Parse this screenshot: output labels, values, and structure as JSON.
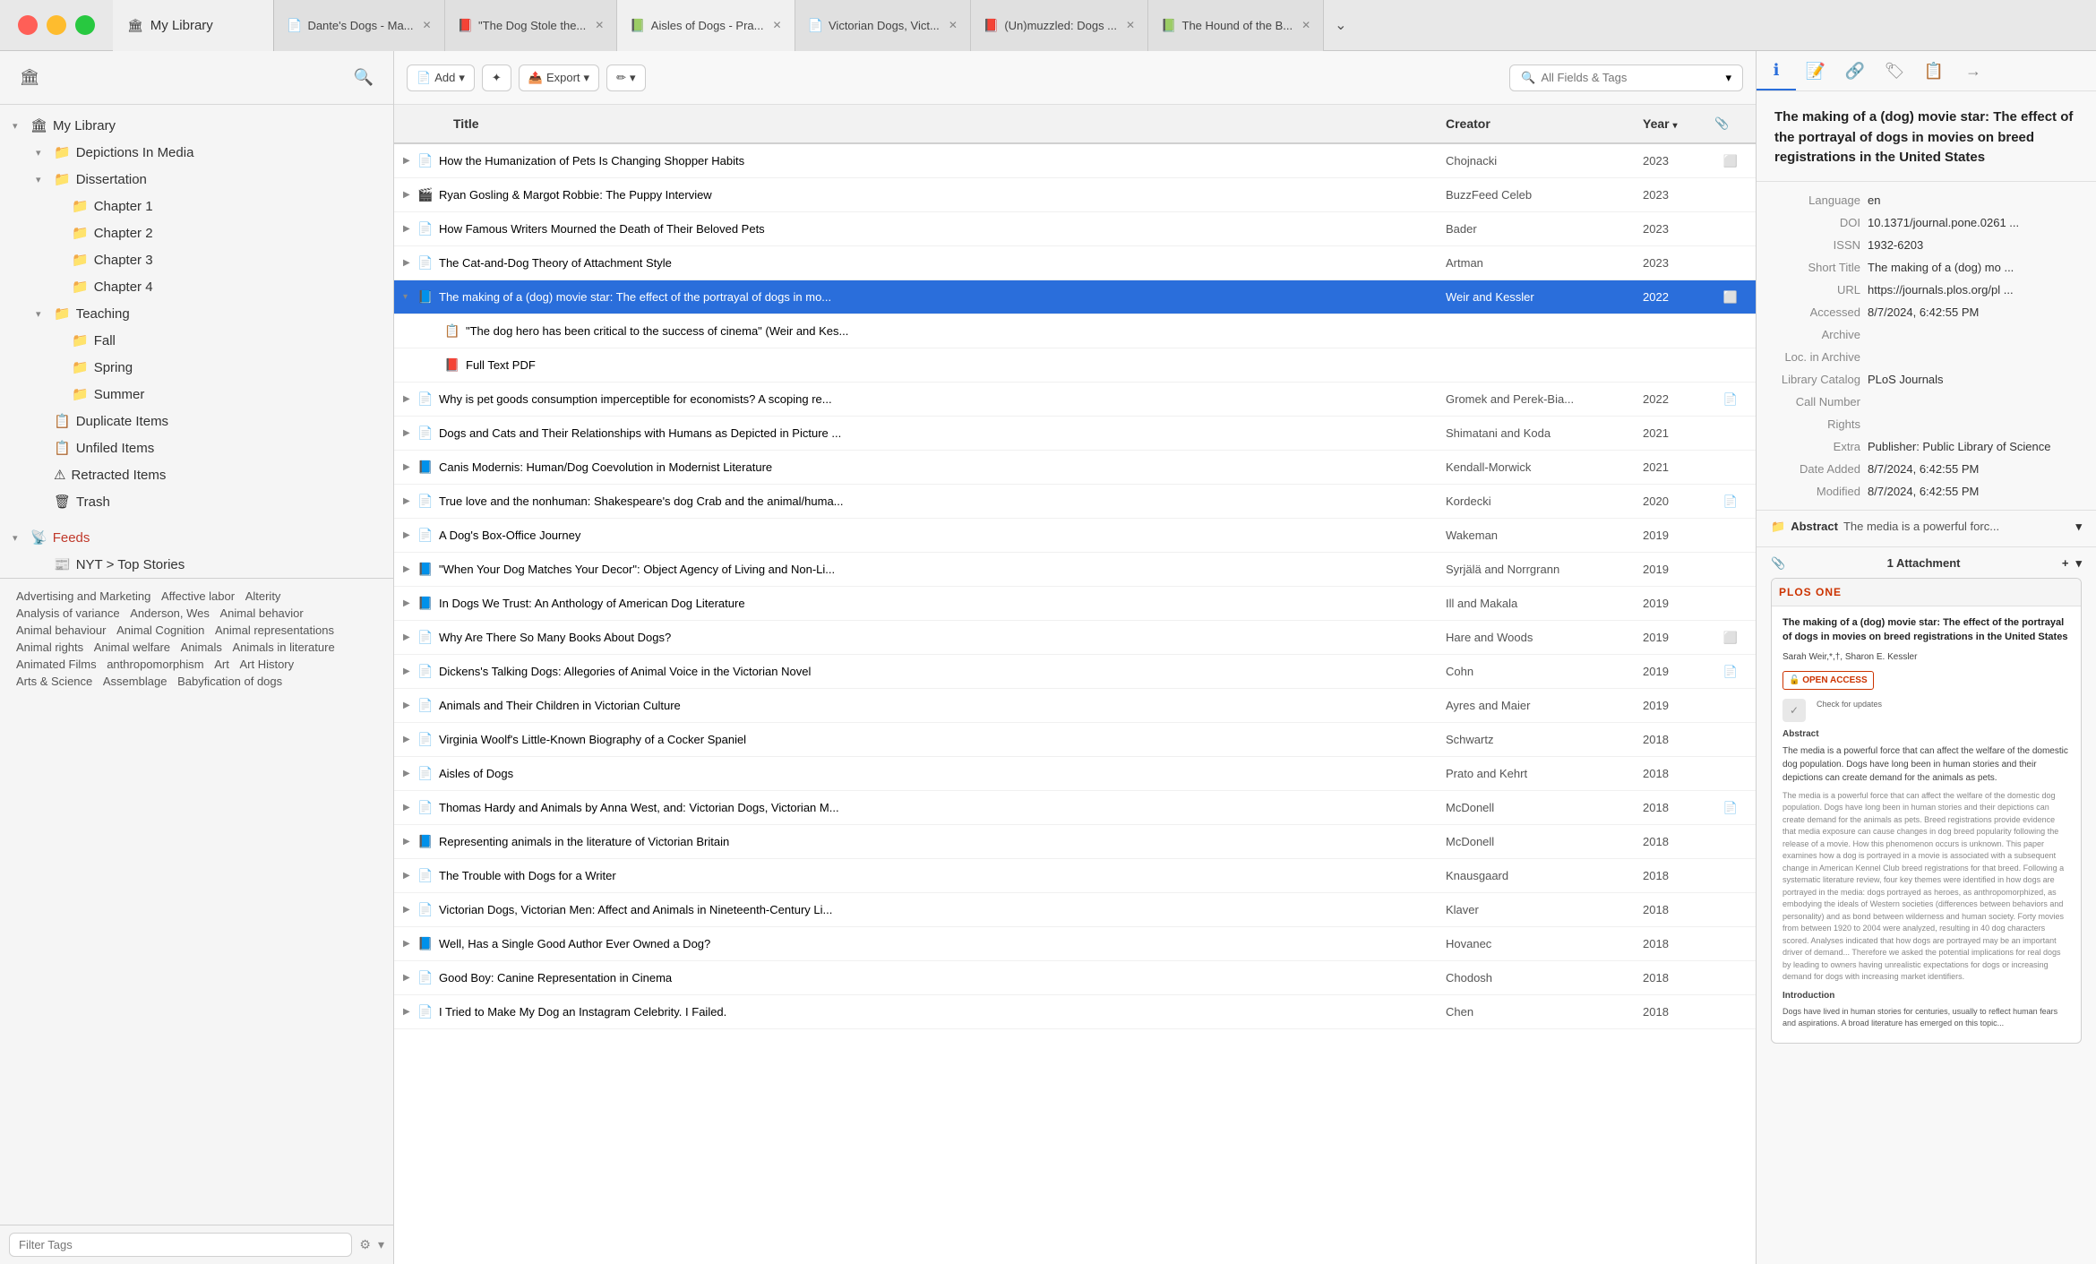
{
  "titleBar": {
    "tabs": [
      {
        "id": "my-library",
        "icon": "🏛",
        "label": "My Library",
        "active": false,
        "closeable": false
      },
      {
        "id": "dantes-dogs",
        "icon": "📄",
        "label": "Dante's Dogs - Ma...",
        "active": false,
        "closeable": true
      },
      {
        "id": "dog-stole",
        "icon": "📕",
        "label": "\"The Dog Stole the...",
        "active": false,
        "closeable": true
      },
      {
        "id": "aisles-of-dogs",
        "icon": "📗",
        "label": "Aisles of Dogs - Pra...",
        "active": true,
        "closeable": true
      },
      {
        "id": "victorian-dogs",
        "icon": "📄",
        "label": "Victorian Dogs, Vict...",
        "active": false,
        "closeable": true
      },
      {
        "id": "unmuzzled",
        "icon": "📕",
        "label": "(Un)muzzled: Dogs ...",
        "active": false,
        "closeable": true
      },
      {
        "id": "hound",
        "icon": "📗",
        "label": "The Hound of the B...",
        "active": false,
        "closeable": true
      }
    ]
  },
  "toolbar": {
    "addBtn": "Add",
    "wandBtn": "✦",
    "exportBtn": "Export",
    "annotateBtn": "✏",
    "searchPlaceholder": "All Fields & Tags"
  },
  "sidebar": {
    "title": "My Library",
    "items": [
      {
        "id": "my-library",
        "label": "My Library",
        "icon": "🏛",
        "arrow": "▾",
        "indent": 0
      },
      {
        "id": "depictions-in-media",
        "label": "Depictions In Media",
        "icon": "📁",
        "arrow": "▾",
        "indent": 1
      },
      {
        "id": "dissertation",
        "label": "Dissertation",
        "icon": "📁",
        "arrow": "▾",
        "indent": 1
      },
      {
        "id": "chapter1",
        "label": "Chapter 1",
        "icon": "📁",
        "arrow": "",
        "indent": 2
      },
      {
        "id": "chapter2",
        "label": "Chapter 2",
        "icon": "📁",
        "arrow": "",
        "indent": 2
      },
      {
        "id": "chapter3",
        "label": "Chapter 3",
        "icon": "📁",
        "arrow": "",
        "indent": 2
      },
      {
        "id": "chapter4",
        "label": "Chapter 4",
        "icon": "📁",
        "arrow": "",
        "indent": 2
      },
      {
        "id": "teaching",
        "label": "Teaching",
        "icon": "📁",
        "arrow": "▾",
        "indent": 1
      },
      {
        "id": "fall",
        "label": "Fall",
        "icon": "📁",
        "arrow": "",
        "indent": 2
      },
      {
        "id": "spring",
        "label": "Spring",
        "icon": "📁",
        "arrow": "",
        "indent": 2
      },
      {
        "id": "summer",
        "label": "Summer",
        "icon": "📁",
        "arrow": "",
        "indent": 2
      },
      {
        "id": "duplicate-items",
        "label": "Duplicate Items",
        "icon": "📋",
        "arrow": "",
        "indent": 1
      },
      {
        "id": "unfiled-items",
        "label": "Unfiled Items",
        "icon": "📋",
        "arrow": "",
        "indent": 1
      },
      {
        "id": "retracted-items",
        "label": "Retracted Items",
        "icon": "⚠",
        "arrow": "",
        "indent": 1
      },
      {
        "id": "trash",
        "label": "Trash",
        "icon": "🗑",
        "arrow": "",
        "indent": 1
      }
    ],
    "feeds": {
      "label": "Feeds",
      "children": [
        {
          "id": "nyt",
          "label": "NYT > Top Stories",
          "icon": "📰"
        }
      ]
    },
    "tags": [
      "Advertising and Marketing",
      "Affective labor",
      "Alterity",
      "Analysis of variance",
      "Anderson, Wes",
      "Animal behavior",
      "Animal behaviour",
      "Animal Cognition",
      "Animal representations",
      "Animal rights",
      "Animal welfare",
      "Animals",
      "Animals in literature",
      "Animated Films",
      "anthropomorphism",
      "Art",
      "Art History",
      "Arts & Science",
      "Assemblage",
      "Babyfication of dogs"
    ],
    "filterPlaceholder": "Filter Tags"
  },
  "tableHeader": {
    "titleCol": "Title",
    "creatorCol": "Creator",
    "yearCol": "Year",
    "attachCol": ""
  },
  "tableRows": [
    {
      "title": "How the Humanization of Pets Is Changing Shopper Habits",
      "creator": "Chojnacki",
      "year": "2023",
      "attach": "cloud",
      "icon": "📄",
      "expanded": false,
      "sub": false
    },
    {
      "title": "Ryan Gosling & Margot Robbie: The Puppy Interview",
      "creator": "BuzzFeed Celeb",
      "year": "2023",
      "attach": "",
      "icon": "🎬",
      "expanded": false,
      "sub": false
    },
    {
      "title": "How Famous Writers Mourned the Death of Their Beloved Pets",
      "creator": "Bader",
      "year": "2023",
      "attach": "",
      "icon": "📄",
      "expanded": false,
      "sub": false
    },
    {
      "title": "The Cat-and-Dog Theory of Attachment Style",
      "creator": "Artman",
      "year": "2023",
      "attach": "",
      "icon": "📄",
      "expanded": false,
      "sub": false
    },
    {
      "title": "The making of a (dog) movie star: The effect of the portrayal of dogs in mo...",
      "creator": "Weir and Kessler",
      "year": "2022",
      "attach": "cloud",
      "icon": "📘",
      "expanded": true,
      "selected": true,
      "sub": false
    },
    {
      "title": "\"The dog hero has been critical to the success of cinema\" (Weir and Kes...",
      "creator": "",
      "year": "",
      "attach": "",
      "icon": "📋",
      "expanded": false,
      "sub": true
    },
    {
      "title": "Full Text PDF",
      "creator": "",
      "year": "",
      "attach": "",
      "icon": "📕",
      "expanded": false,
      "sub": true
    },
    {
      "title": "Why is pet goods consumption imperceptible for economists? A scoping re...",
      "creator": "Gromek and Perek-Bia...",
      "year": "2022",
      "attach": "pdf",
      "icon": "📄",
      "expanded": false,
      "sub": false
    },
    {
      "title": "Dogs and Cats and Their Relationships with Humans as Depicted in Picture ...",
      "creator": "Shimatani and Koda",
      "year": "2021",
      "attach": "",
      "icon": "📄",
      "expanded": false,
      "sub": false
    },
    {
      "title": "Canis Modernis: Human/Dog Coevolution in Modernist Literature",
      "creator": "Kendall-Morwick",
      "year": "2021",
      "attach": "",
      "icon": "📘",
      "expanded": false,
      "sub": false
    },
    {
      "title": "True love and the nonhuman: Shakespeare's dog Crab and the animal/huma...",
      "creator": "Kordecki",
      "year": "2020",
      "attach": "pdf",
      "icon": "📄",
      "expanded": false,
      "sub": false
    },
    {
      "title": "A Dog's Box-Office Journey",
      "creator": "Wakeman",
      "year": "2019",
      "attach": "",
      "icon": "📄",
      "expanded": false,
      "sub": false
    },
    {
      "title": "\"When Your Dog Matches Your Decor\": Object Agency of Living and Non-Li...",
      "creator": "Syrjälä and Norrgrann",
      "year": "2019",
      "attach": "",
      "icon": "📘",
      "expanded": false,
      "sub": false
    },
    {
      "title": "In Dogs We Trust: An Anthology of American Dog Literature",
      "creator": "Ill and Makala",
      "year": "2019",
      "attach": "",
      "icon": "📘",
      "expanded": false,
      "sub": false
    },
    {
      "title": "Why Are There So Many Books About Dogs?",
      "creator": "Hare and Woods",
      "year": "2019",
      "attach": "cloud",
      "icon": "📄",
      "expanded": false,
      "sub": false
    },
    {
      "title": "Dickens's Talking Dogs: Allegories of Animal Voice in the Victorian Novel",
      "creator": "Cohn",
      "year": "2019",
      "attach": "pdf",
      "icon": "📄",
      "expanded": false,
      "sub": false
    },
    {
      "title": "Animals and Their Children in Victorian Culture",
      "creator": "Ayres and Maier",
      "year": "2019",
      "attach": "",
      "icon": "📄",
      "expanded": false,
      "sub": false
    },
    {
      "title": "Virginia Woolf's Little-Known Biography of a Cocker Spaniel",
      "creator": "Schwartz",
      "year": "2018",
      "attach": "",
      "icon": "📄",
      "expanded": false,
      "sub": false
    },
    {
      "title": "Aisles of Dogs",
      "creator": "Prato and Kehrt",
      "year": "2018",
      "attach": "",
      "icon": "📄",
      "expanded": false,
      "sub": false
    },
    {
      "title": "Thomas Hardy and Animals by Anna West, and: Victorian Dogs, Victorian M...",
      "creator": "McDonell",
      "year": "2018",
      "attach": "pdf",
      "icon": "📄",
      "expanded": false,
      "sub": false
    },
    {
      "title": "Representing animals in the literature of Victorian Britain",
      "creator": "McDonell",
      "year": "2018",
      "attach": "",
      "icon": "📘",
      "expanded": false,
      "sub": false
    },
    {
      "title": "The Trouble with Dogs for a Writer",
      "creator": "Knausgaard",
      "year": "2018",
      "attach": "",
      "icon": "📄",
      "expanded": false,
      "sub": false
    },
    {
      "title": "Victorian Dogs, Victorian Men: Affect and Animals in Nineteenth-Century Li...",
      "creator": "Klaver",
      "year": "2018",
      "attach": "",
      "icon": "📄",
      "expanded": false,
      "sub": false
    },
    {
      "title": "Well, Has a Single Good Author Ever Owned a Dog?",
      "creator": "Hovanec",
      "year": "2018",
      "attach": "",
      "icon": "📘",
      "expanded": false,
      "sub": false
    },
    {
      "title": "Good Boy: Canine Representation in Cinema",
      "creator": "Chodosh",
      "year": "2018",
      "attach": "",
      "icon": "📄",
      "expanded": false,
      "sub": false
    },
    {
      "title": "I Tried to Make My Dog an Instagram Celebrity. I Failed.",
      "creator": "Chen",
      "year": "2018",
      "attach": "",
      "icon": "📄",
      "expanded": false,
      "sub": false
    }
  ],
  "rightPanel": {
    "title": "The making of a (dog) movie star: The effect of the portrayal of dogs in movies on breed registrations in the United States",
    "meta": [
      {
        "label": "Language",
        "value": "en"
      },
      {
        "label": "DOI",
        "value": "10.1371/journal.pone.0261 ..."
      },
      {
        "label": "ISSN",
        "value": "1932-6203"
      },
      {
        "label": "Short Title",
        "value": "The making of a (dog) mo ..."
      },
      {
        "label": "URL",
        "value": "https://journals.plos.org/pl ..."
      },
      {
        "label": "Accessed",
        "value": "8/7/2024, 6:42:55 PM"
      },
      {
        "label": "Archive",
        "value": ""
      },
      {
        "label": "Loc. in Archive",
        "value": ""
      },
      {
        "label": "Library Catalog",
        "value": "PLoS Journals"
      },
      {
        "label": "Call Number",
        "value": ""
      },
      {
        "label": "Rights",
        "value": ""
      },
      {
        "label": "Extra",
        "value": "Publisher: Public Library of Science"
      },
      {
        "label": "Date Added",
        "value": "8/7/2024, 6:42:55 PM"
      },
      {
        "label": "Modified",
        "value": "8/7/2024, 6:42:55 PM"
      }
    ],
    "abstract": {
      "label": "Abstract",
      "text": "The media is a powerful forc..."
    },
    "attachment": {
      "count": "1 Attachment",
      "previewBrand": "PLOS ONE",
      "previewTitle": "The making of a (dog) movie star: The effect of the portrayal of dogs in movies on breed registrations in the United States",
      "previewAuthors": "Sarah Weir,*,†, Sharon E. Kessler",
      "previewAbstract": "The media is a powerful force that can affect the welfare of the domestic dog population. Dogs have long been in human stories and their depictions can create demand for the animals as pets."
    }
  }
}
